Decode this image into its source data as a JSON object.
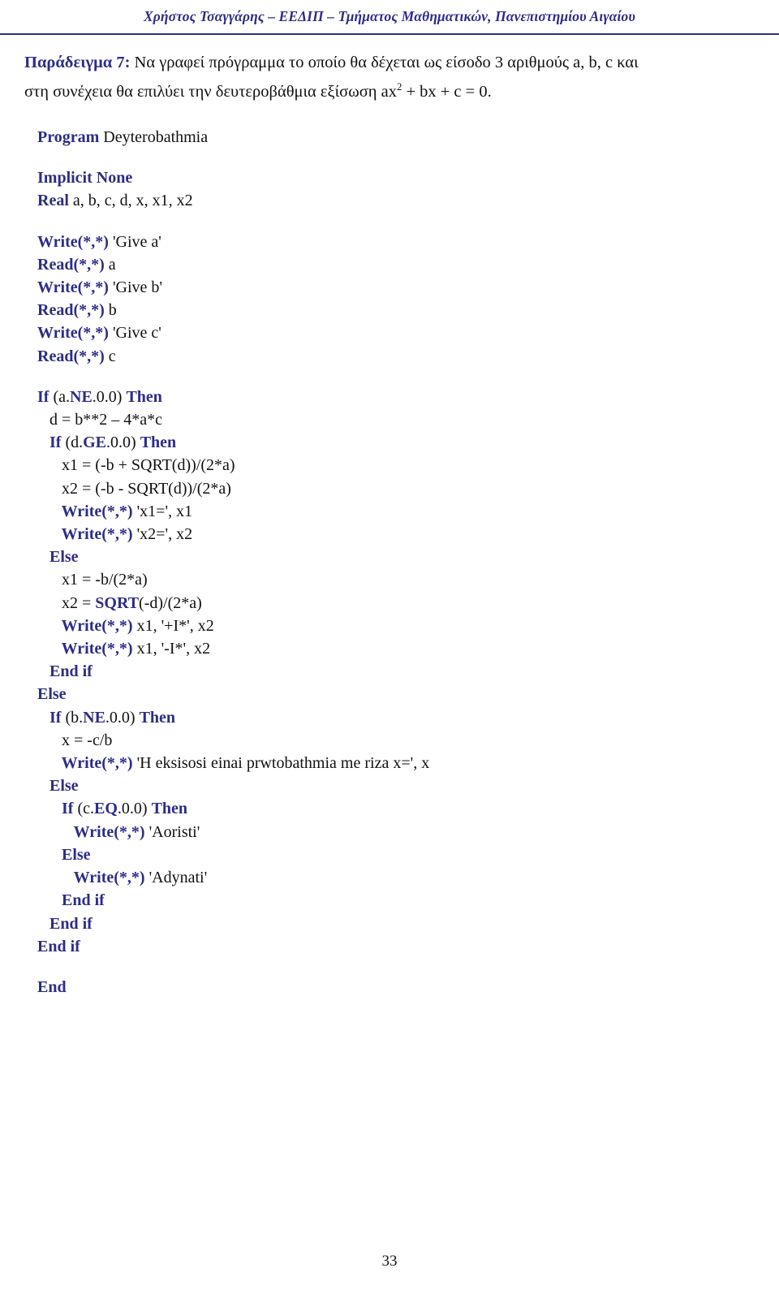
{
  "header": {
    "text": "Χρήστος Τσαγγάρης – ΕΕΔΙΠ – Τμήματος Μαθηματικών, Πανεπιστημίου Αιγαίου"
  },
  "intro": {
    "label": "Παράδειγμα 7:",
    "line1_rest": " Να γραφεί πρόγραμμα το οποίο θα δέχεται ως είσοδο 3 αριθμούς a, b, c και",
    "line2_a": "στη συνέχεια θα επιλύει την δευτεροβάθμια εξίσωση ax",
    "line2_sup": "2",
    "line2_b": " + bx + c = 0."
  },
  "code": {
    "lines": [
      {
        "kw": "Program ",
        "plain": "Deyterobathmia"
      },
      {
        "kw": "",
        "plain": ""
      },
      {
        "kw": "Implicit None",
        "plain": ""
      },
      {
        "kw": "Real ",
        "plain": "a, b, c, d, x, x1, x2"
      },
      {
        "kw": "",
        "plain": ""
      },
      {
        "kw": "Write(*,*) ",
        "plain": "'Give a'"
      },
      {
        "kw": "Read(*,*) ",
        "plain": "a"
      },
      {
        "kw": "Write(*,*) ",
        "plain": "'Give b'"
      },
      {
        "kw": "Read(*,*) ",
        "plain": "b"
      },
      {
        "kw": "Write(*,*) ",
        "plain": "'Give c'"
      },
      {
        "kw": "Read(*,*) ",
        "plain": "c"
      },
      {
        "kw": "",
        "plain": ""
      },
      {
        "kw": "If ",
        "plain": "(a.",
        "kw2": "NE",
        "plain2": ".0.0) ",
        "kw3": "Then"
      },
      {
        "kw": "",
        "plain": "   d = b**2 – 4*a*c"
      },
      {
        "kw": "   If ",
        "plain": "(d.",
        "kw2": "GE",
        "plain2": ".0.0) ",
        "kw3": "Then"
      },
      {
        "kw": "",
        "plain": "      x1 = (-b + SQRT(d))/(2*a)"
      },
      {
        "kw": "",
        "plain": "      x2 = (-b - SQRT(d))/(2*a)"
      },
      {
        "kw": "      Write(*,*) ",
        "plain": "'x1=', x1"
      },
      {
        "kw": "      Write(*,*) ",
        "plain": "'x2=', x2"
      },
      {
        "kw": "   Else",
        "plain": ""
      },
      {
        "kw": "",
        "plain": "      x1 = -b/(2*a)"
      },
      {
        "kw": "",
        "plain": "      x2 = ",
        "kw2": "SQRT",
        "plain2": "(-d)/(2*a)"
      },
      {
        "kw": "      Write(*,*) ",
        "plain": "x1, '+I*', x2"
      },
      {
        "kw": "      Write(*,*) ",
        "plain": "x1, '-I*', x2"
      },
      {
        "kw": "   End if",
        "plain": ""
      },
      {
        "kw": "Else",
        "plain": ""
      },
      {
        "kw": "   If ",
        "plain": "(b.",
        "kw2": "NE",
        "plain2": ".0.0) ",
        "kw3": "Then"
      },
      {
        "kw": "",
        "plain": "      x = -c/b"
      },
      {
        "kw": "      Write(*,*) ",
        "plain": "'H eksisosi einai prwtobathmia me riza x=', x"
      },
      {
        "kw": "   Else",
        "plain": ""
      },
      {
        "kw": "      If ",
        "plain": "(c.",
        "kw2": "EQ",
        "plain2": ".0.0) ",
        "kw3": "Then"
      },
      {
        "kw": "         Write(*,*) ",
        "plain": "'Aoristi'"
      },
      {
        "kw": "      Else",
        "plain": ""
      },
      {
        "kw": "         Write(*,*) ",
        "plain": "'Adynati'"
      },
      {
        "kw": "      End if",
        "plain": ""
      },
      {
        "kw": "   End if",
        "plain": ""
      },
      {
        "kw": "End if",
        "plain": ""
      },
      {
        "kw": "",
        "plain": ""
      },
      {
        "kw": "End",
        "plain": ""
      }
    ]
  },
  "footer": {
    "page_number": "33"
  }
}
